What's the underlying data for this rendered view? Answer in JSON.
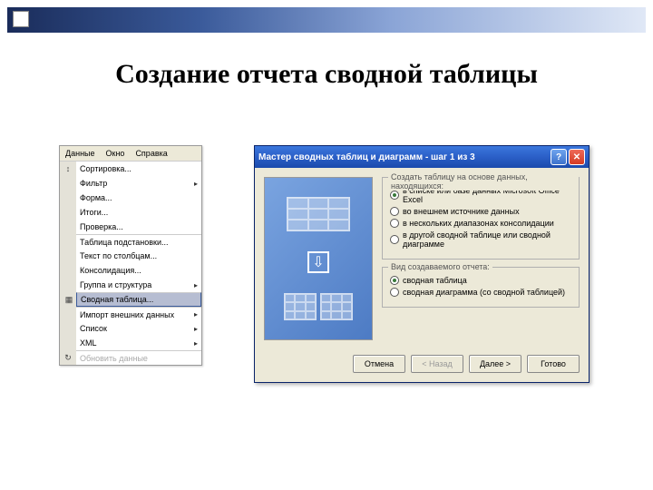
{
  "slide": {
    "title": "Создание отчета сводной таблицы"
  },
  "menu": {
    "bar": [
      "Данные",
      "Окно",
      "Справка"
    ],
    "items": [
      {
        "label": "Сортировка...",
        "icon": "↕"
      },
      {
        "label": "Фильтр",
        "submenu": true
      },
      {
        "label": "Форма..."
      },
      {
        "label": "Итоги..."
      },
      {
        "label": "Проверка..."
      },
      {
        "label": "Таблица подстановки...",
        "sep": true
      },
      {
        "label": "Текст по столбцам..."
      },
      {
        "label": "Консолидация..."
      },
      {
        "label": "Группа и структура",
        "submenu": true
      },
      {
        "label": "Сводная таблица...",
        "icon": "▦",
        "active": true,
        "sep": true
      },
      {
        "label": "Импорт внешних данных",
        "submenu": true,
        "sep": true
      },
      {
        "label": "Список",
        "submenu": true
      },
      {
        "label": "XML",
        "submenu": true
      },
      {
        "label": "Обновить данные",
        "icon": "↻",
        "disabled": true,
        "sep": true
      }
    ]
  },
  "wizard": {
    "title": "Мастер сводных таблиц и диаграмм - шаг 1 из 3",
    "group1": {
      "legend": "Создать таблицу на основе данных, находящихся:",
      "options": [
        {
          "label": "в списке или базе данных Microsoft Office Excel",
          "checked": true
        },
        {
          "label": "во внешнем источнике данных"
        },
        {
          "label": "в нескольких диапазонах консолидации"
        },
        {
          "label": "в другой сводной таблице или сводной диаграмме"
        }
      ]
    },
    "group2": {
      "legend": "Вид создаваемого отчета:",
      "options": [
        {
          "label": "сводная таблица",
          "checked": true
        },
        {
          "label": "сводная диаграмма (со сводной таблицей)"
        }
      ]
    },
    "buttons": {
      "cancel": "Отмена",
      "back": "< Назад",
      "next": "Далее >",
      "finish": "Готово"
    }
  }
}
